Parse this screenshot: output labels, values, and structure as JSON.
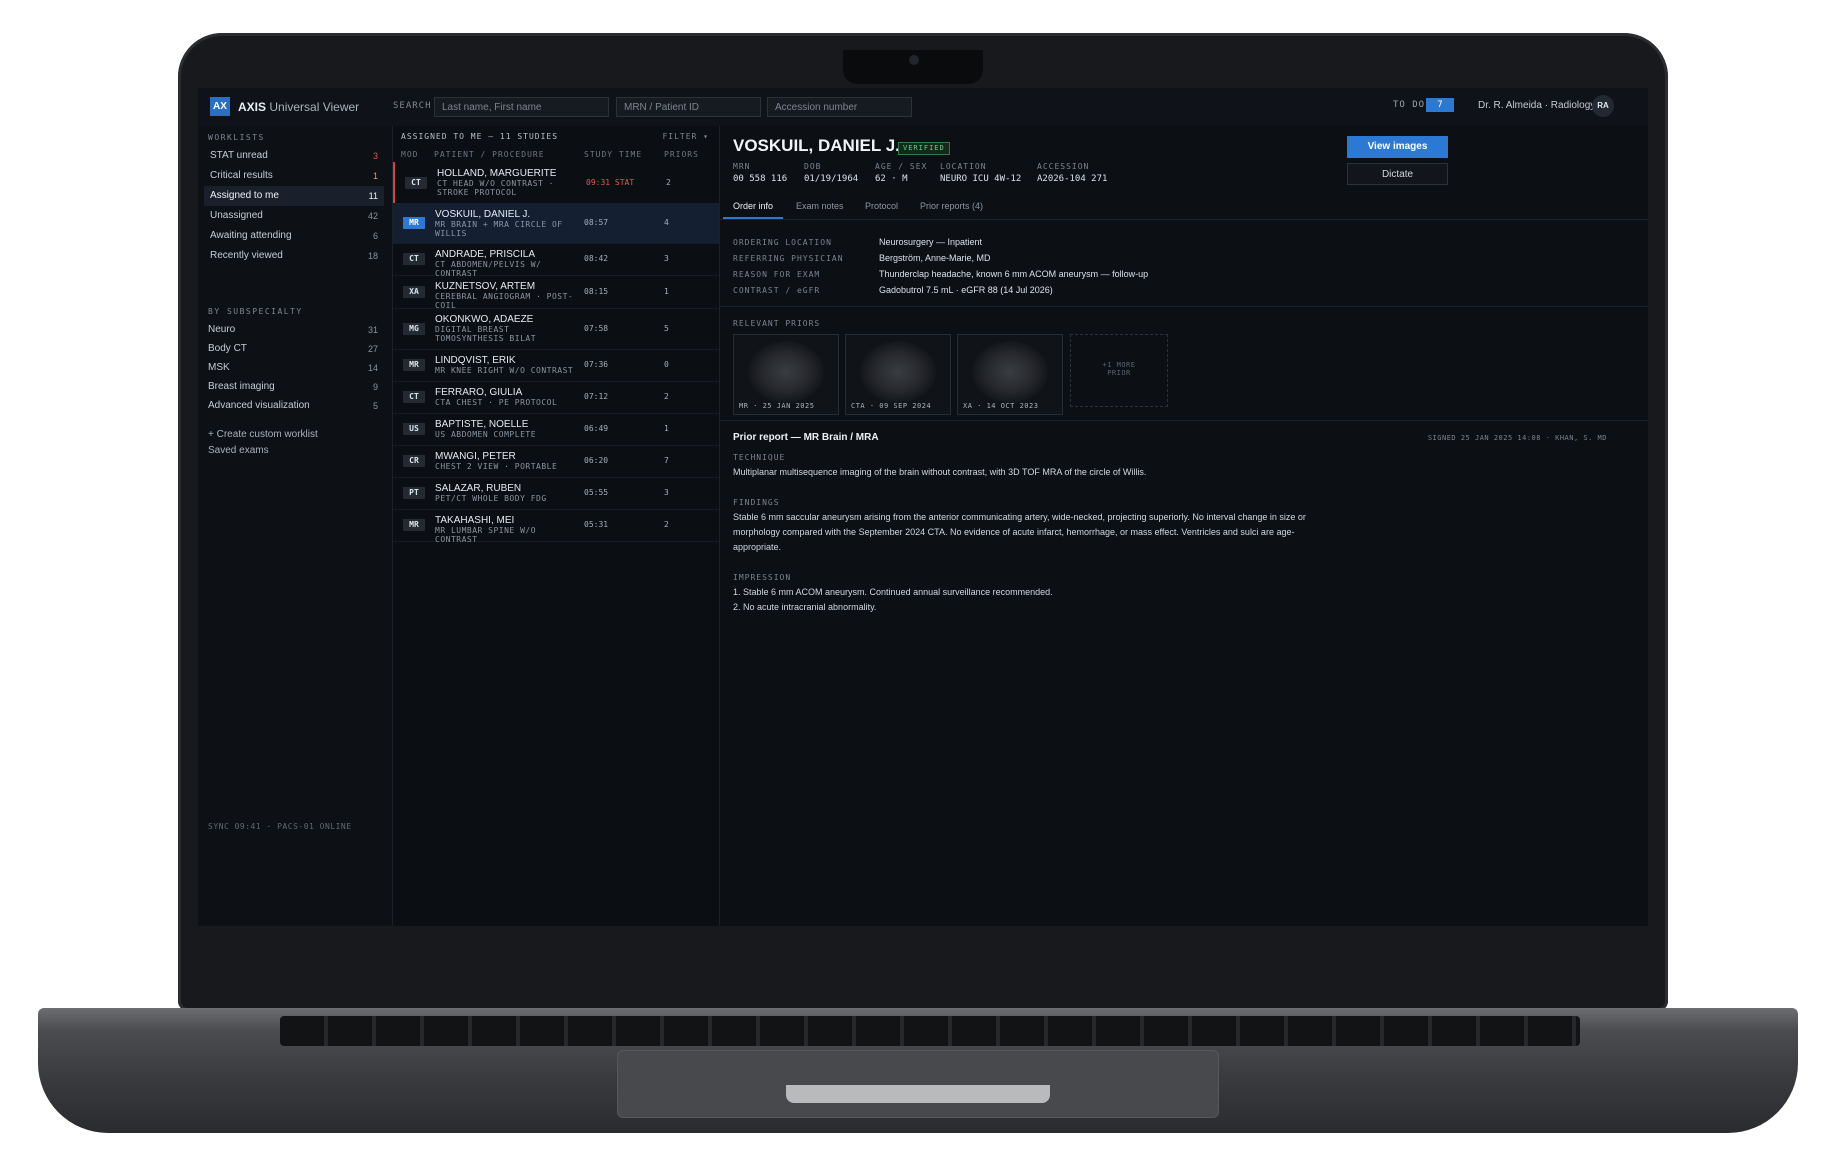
{
  "app": {
    "logo": "AX",
    "name": "AXIS",
    "subtitle": "Universal Viewer"
  },
  "search": {
    "label": "SEARCH",
    "name_placeholder": "Last name, First name",
    "mrn_placeholder": "MRN / Patient ID",
    "accession_placeholder": "Accession number"
  },
  "header": {
    "todo_label": "TO DO",
    "todo_count": "7",
    "user": "Dr. R. Almeida · Radiology",
    "avatar": "RA"
  },
  "sidebar": {
    "worklists_heading": "WORKLISTS",
    "worklists": [
      {
        "label": "STAT unread",
        "count": "3"
      },
      {
        "label": "Critical results",
        "count": "1"
      },
      {
        "label": "Assigned to me",
        "count": "11"
      },
      {
        "label": "Unassigned",
        "count": "42"
      },
      {
        "label": "Awaiting attending",
        "count": "6"
      },
      {
        "label": "Recently viewed",
        "count": "18"
      }
    ],
    "subspecialty_heading": "BY SUBSPECIALTY",
    "subspecialties": [
      {
        "label": "Neuro",
        "count": "31"
      },
      {
        "label": "Body CT",
        "count": "27"
      },
      {
        "label": "MSK",
        "count": "14"
      },
      {
        "label": "Breast imaging",
        "count": "9"
      },
      {
        "label": "Advanced visualization",
        "count": "5"
      }
    ],
    "create_link": "+ Create custom worklist",
    "saved_link": "Saved exams",
    "status": "SYNC 09:41 · PACS-01 ONLINE"
  },
  "worklist": {
    "heading": "ASSIGNED TO ME — 11 STUDIES",
    "filter": "FILTER ▾",
    "columns": {
      "mod": "MOD",
      "patient": "PATIENT / PROCEDURE",
      "time": "STUDY TIME",
      "priors": "PRIORS"
    },
    "rows": [
      {
        "mod": "CT",
        "name": "HOLLAND, MARGUERITE",
        "proc": "CT HEAD W/O CONTRAST · STROKE PROTOCOL",
        "time": "09:31 STAT",
        "priors": "2"
      },
      {
        "mod": "MR",
        "name": "VOSKUIL, DANIEL J.",
        "proc": "MR BRAIN + MRA CIRCLE OF WILLIS",
        "time": "08:57",
        "priors": "4"
      },
      {
        "mod": "CT",
        "name": "ANDRADE, PRISCILA",
        "proc": "CT ABDOMEN/PELVIS W/ CONTRAST",
        "time": "08:42",
        "priors": "3"
      },
      {
        "mod": "XA",
        "name": "KUZNETSOV, ARTEM",
        "proc": "CEREBRAL ANGIOGRAM · POST-COIL",
        "time": "08:15",
        "priors": "1"
      },
      {
        "mod": "MG",
        "name": "OKONKWO, ADAEZE",
        "proc": "DIGITAL BREAST TOMOSYNTHESIS BILAT",
        "time": "07:58",
        "priors": "5"
      },
      {
        "mod": "MR",
        "name": "LINDQVIST, ERIK",
        "proc": "MR KNEE RIGHT W/O CONTRAST",
        "time": "07:36",
        "priors": "0"
      },
      {
        "mod": "CT",
        "name": "FERRARO, GIULIA",
        "proc": "CTA CHEST · PE PROTOCOL",
        "time": "07:12",
        "priors": "2"
      },
      {
        "mod": "US",
        "name": "BAPTISTE, NOELLE",
        "proc": "US ABDOMEN COMPLETE",
        "time": "06:49",
        "priors": "1"
      },
      {
        "mod": "CR",
        "name": "MWANGI, PETER",
        "proc": "CHEST 2 VIEW · PORTABLE",
        "time": "06:20",
        "priors": "7"
      },
      {
        "mod": "PT",
        "name": "SALAZAR, RUBEN",
        "proc": "PET/CT WHOLE BODY FDG",
        "time": "05:55",
        "priors": "3"
      },
      {
        "mod": "MR",
        "name": "TAKAHASHI, MEI",
        "proc": "MR LUMBAR SPINE W/O CONTRAST",
        "time": "05:31",
        "priors": "2"
      }
    ]
  },
  "patient": {
    "name": "VOSKUIL, DANIEL J.",
    "status": "VERIFIED",
    "meta": [
      {
        "label": "MRN",
        "value": "00 558 116"
      },
      {
        "label": "DOB",
        "value": "01/19/1964"
      },
      {
        "label": "AGE / SEX",
        "value": "62 · M"
      },
      {
        "label": "LOCATION",
        "value": "NEURO ICU 4W-12"
      },
      {
        "label": "ACCESSION",
        "value": "A2026-104 271"
      }
    ],
    "view_button": "View images",
    "dictate_button": "Dictate"
  },
  "tabs": [
    "Order info",
    "Exam notes",
    "Protocol",
    "Prior reports (4)"
  ],
  "order_info": [
    {
      "label": "ORDERING LOCATION",
      "value": "Neurosurgery — Inpatient"
    },
    {
      "label": "REFERRING PHYSICIAN",
      "value": "Bergström, Anne-Marie, MD"
    },
    {
      "label": "REASON FOR EXAM",
      "value": "Thunderclap headache, known 6 mm ACOM aneurysm — follow-up"
    },
    {
      "label": "CONTRAST / eGFR",
      "value": "Gadobutrol 7.5 mL · eGFR 88 (14 Jul 2026)"
    }
  ],
  "priors": {
    "heading": "RELEVANT PRIORS",
    "items": [
      "MR · 25 JAN 2025",
      "CTA · 09 SEP 2024",
      "XA · 14 OCT 2023"
    ],
    "more_line1": "+1 MORE",
    "more_line2": "PRIOR"
  },
  "report": {
    "title": "Prior report — MR Brain / MRA",
    "signed": "SIGNED 25 JAN 2025 14:08 · KHAN, S. MD",
    "technique_label": "TECHNIQUE",
    "technique": "Multiplanar multisequence imaging of the brain without contrast, with 3D TOF MRA of the circle of Willis.",
    "findings_label": "FINDINGS",
    "findings": "Stable 6 mm saccular aneurysm arising from the anterior communicating artery, wide-necked, projecting superiorly. No interval change in size or morphology compared with the September 2024 CTA. No evidence of acute infarct, hemorrhage, or mass effect. Ventricles and sulci are age-appropriate.",
    "impression_label": "IMPRESSION",
    "impression": [
      "1. Stable 6 mm ACOM aneurysm. Continued annual surveillance recommended.",
      "2. No acute intracranial abnormality."
    ]
  }
}
